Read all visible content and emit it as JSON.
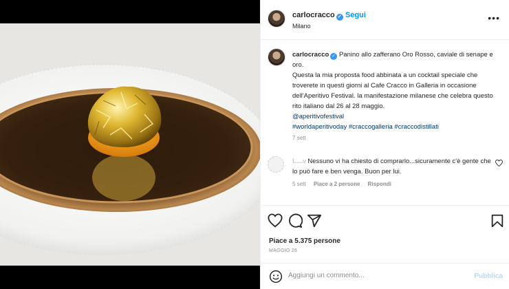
{
  "post": {
    "username": "carlocracco",
    "follow_label": "Segui",
    "location": "Milano",
    "more_label": "•••"
  },
  "caption": {
    "username": "carlocracco",
    "text_line1": "Panino allo zafferano Oro Rosso, caviale di senape e oro.",
    "text_body": "Questa la mia proposta food abbinata a un cocktail speciale che troverete in questi giorni al Cafe Cracco in Galleria in occasione dell'Aperitivo Festival. la manifestazione milanese che celebra questo rito italiano dal 26 al 28 maggio.",
    "mention": "@aperitivofestival",
    "hashtags": [
      "#worldaperitivoday",
      "#craccogalleria",
      "#craccodistillati"
    ],
    "time": "7 sett"
  },
  "comment": {
    "username": "l......v",
    "text": "Nessuno vi ha chiesto di comprarlo...sicuramente c'è gente che lo può fare e ben venga. Buon per lui.",
    "time": "5 sett",
    "likes": "Piace a 2 persone",
    "reply": "Rispondi"
  },
  "stats": {
    "likes": "Piace a 5.375 persone",
    "date": "MAGGIO 26"
  },
  "add_comment": {
    "placeholder": "Aggiungi un commento...",
    "publish": "Pubblica"
  },
  "icons": {
    "like": "heart-icon",
    "comment": "comment-icon",
    "share": "share-icon",
    "save": "bookmark-icon",
    "emoji": "emoji-icon"
  },
  "colors": {
    "accent": "#0095f6",
    "link": "#00376b",
    "muted": "#8e8e8e",
    "publish_disabled": "#b3dbff"
  }
}
